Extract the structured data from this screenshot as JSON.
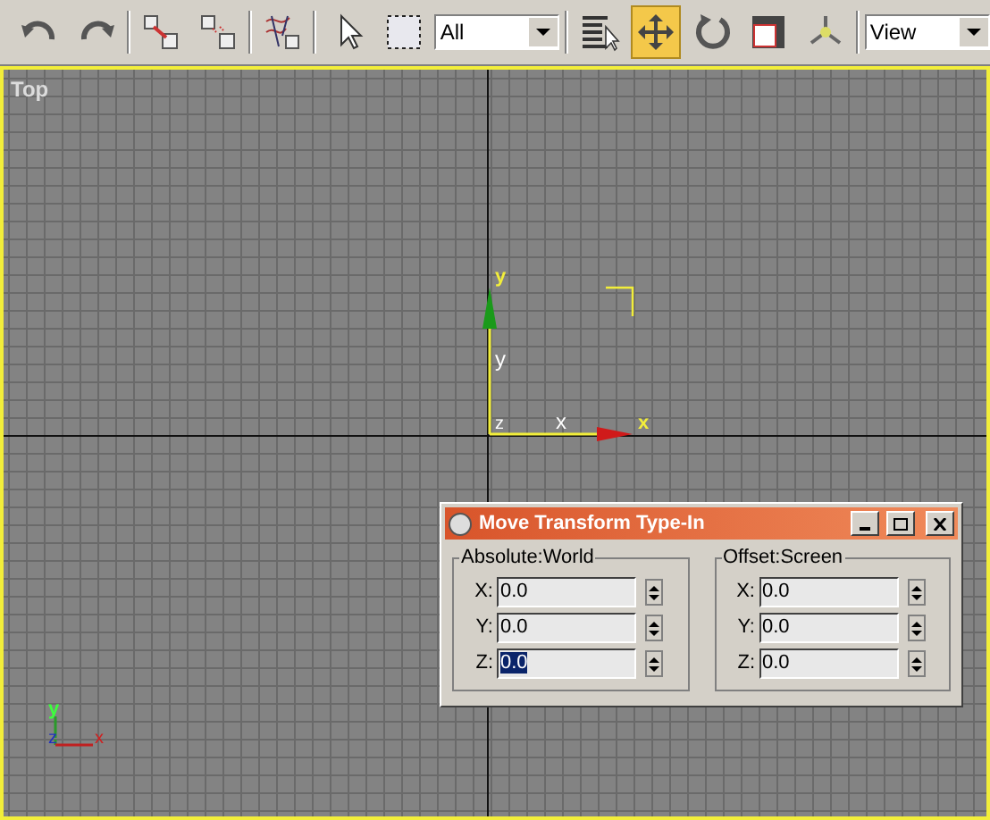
{
  "toolbar": {
    "items": [
      {
        "kind": "tool",
        "selected": false
      },
      {
        "kind": "tool",
        "selected": false
      },
      {
        "kind": "sep"
      },
      {
        "kind": "tool",
        "selected": false
      },
      {
        "kind": "tool",
        "selected": false
      },
      {
        "kind": "sep"
      },
      {
        "kind": "tool",
        "selected": false
      },
      {
        "kind": "sep"
      },
      {
        "kind": "tool",
        "selected": false
      },
      {
        "kind": "tool",
        "selected": false
      },
      {
        "kind": "dropdown",
        "value": "All"
      },
      {
        "kind": "sep"
      },
      {
        "kind": "tool",
        "selected": false
      },
      {
        "kind": "tool",
        "selected": true
      },
      {
        "kind": "tool",
        "selected": false
      },
      {
        "kind": "tool",
        "selected": false
      },
      {
        "kind": "tool",
        "selected": false
      },
      {
        "kind": "sep"
      },
      {
        "kind": "dropdown",
        "value": "View"
      }
    ]
  },
  "viewport": {
    "label": "Top",
    "active": true,
    "gizmo": {
      "y_label": "y",
      "y_plane": "y",
      "x_plane": "x",
      "x_label": "x",
      "z_label": "z"
    },
    "triad": {
      "y": "y",
      "z": "z",
      "x": "x"
    }
  },
  "dialog": {
    "title": "Move Transform Type-In",
    "groups": [
      {
        "title": "Absolute:World",
        "fields": [
          {
            "label": "X:",
            "value": "0.0",
            "selected": false
          },
          {
            "label": "Y:",
            "value": "0.0",
            "selected": false
          },
          {
            "label": "Z:",
            "value": "0.0",
            "selected": true
          }
        ]
      },
      {
        "title": "Offset:Screen",
        "fields": [
          {
            "label": "X:",
            "value": "0.0",
            "selected": false
          },
          {
            "label": "Y:",
            "value": "0.0",
            "selected": false
          },
          {
            "label": "Z:",
            "value": "0.0",
            "selected": false
          }
        ]
      }
    ]
  }
}
